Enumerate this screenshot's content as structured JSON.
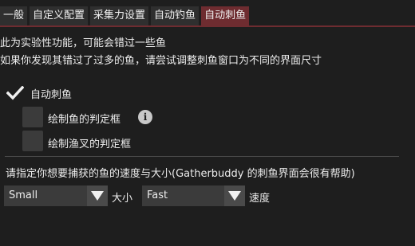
{
  "tabs": [
    {
      "label": "一般"
    },
    {
      "label": "自定义配置"
    },
    {
      "label": "采集力设置"
    },
    {
      "label": "自动钓鱼"
    },
    {
      "label": "自动刺鱼"
    }
  ],
  "active_tab": 4,
  "notice": {
    "line1": "此为实验性功能，可能会错过一些鱼",
    "line2": "如果你发现其错过了过多的鱼，请尝试调整刺鱼窗口为不同的界面尺寸"
  },
  "options": {
    "auto_spearfish": {
      "label": "自动刺鱼",
      "checked": true
    },
    "draw_fish_box": {
      "label": "绘制鱼的判定框",
      "checked": false
    },
    "draw_spear_box": {
      "label": "绘制渔叉的判定框",
      "checked": false
    }
  },
  "info_icon": "i",
  "target": {
    "prompt": "请指定你想要捕获的鱼的速度与大小(Gatherbuddy 的刺鱼界面会很有帮助)",
    "size_value": "Small",
    "size_label": "大小",
    "speed_value": "Fast",
    "speed_label": "速度"
  },
  "colors": {
    "active_tab": "#6e2c30",
    "background": "#1e1e1e",
    "control": "#3b3b3b"
  }
}
